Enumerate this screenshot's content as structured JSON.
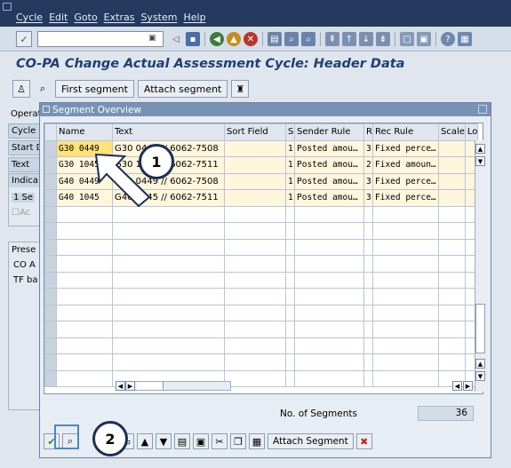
{
  "menu": [
    "Cycle",
    "Edit",
    "Goto",
    "Extras",
    "System",
    "Help"
  ],
  "title": "CO-PA Change Actual Assessment Cycle: Header Data",
  "app_toolbar": {
    "first_segment": "First segment",
    "attach_segment": "Attach segment"
  },
  "background_labels": [
    "Operat",
    "Cycle",
    "Start D",
    "Text",
    "Indica",
    "1 Se",
    "Ac",
    "Prese",
    "CO A",
    "TF ba"
  ],
  "popup": {
    "title": "Segment Overview",
    "columns": [
      "Name",
      "Text",
      "Sort Field",
      "S",
      "Sender Rule",
      "R",
      "Rec Rule",
      "Scale",
      "Lo"
    ],
    "rows": [
      {
        "name": "G30 0449",
        "text": "G30 0449 // 6062-7508",
        "s": "1",
        "sender_rule": "Posted amou…",
        "r": "3",
        "rec_rule": "Fixed perce…"
      },
      {
        "name": "G30 1045",
        "text": "G30 1045 // 6062-7511",
        "s": "1",
        "sender_rule": "Posted amou…",
        "r": "2",
        "rec_rule": "Fixed amoun…"
      },
      {
        "name": "G40 0449",
        "text": "G40 0449 // 6062-7508",
        "s": "1",
        "sender_rule": "Posted amou…",
        "r": "3",
        "rec_rule": "Fixed perce…"
      },
      {
        "name": "G40 1045",
        "text": "G40 1045 // 6062-7511",
        "s": "1",
        "sender_rule": "Posted amou…",
        "r": "3",
        "rec_rule": "Fixed perce…"
      }
    ],
    "no_of_segments_label": "No. of Segments",
    "no_of_segments_value": "36",
    "attach_segment_btn": "Attach Segment"
  },
  "callouts": [
    "1",
    "2"
  ],
  "colors": {
    "menubar": "#243a5e",
    "title": "#1f3f73",
    "popup_header": "#7892b6",
    "highlight": "#ffe27a"
  }
}
